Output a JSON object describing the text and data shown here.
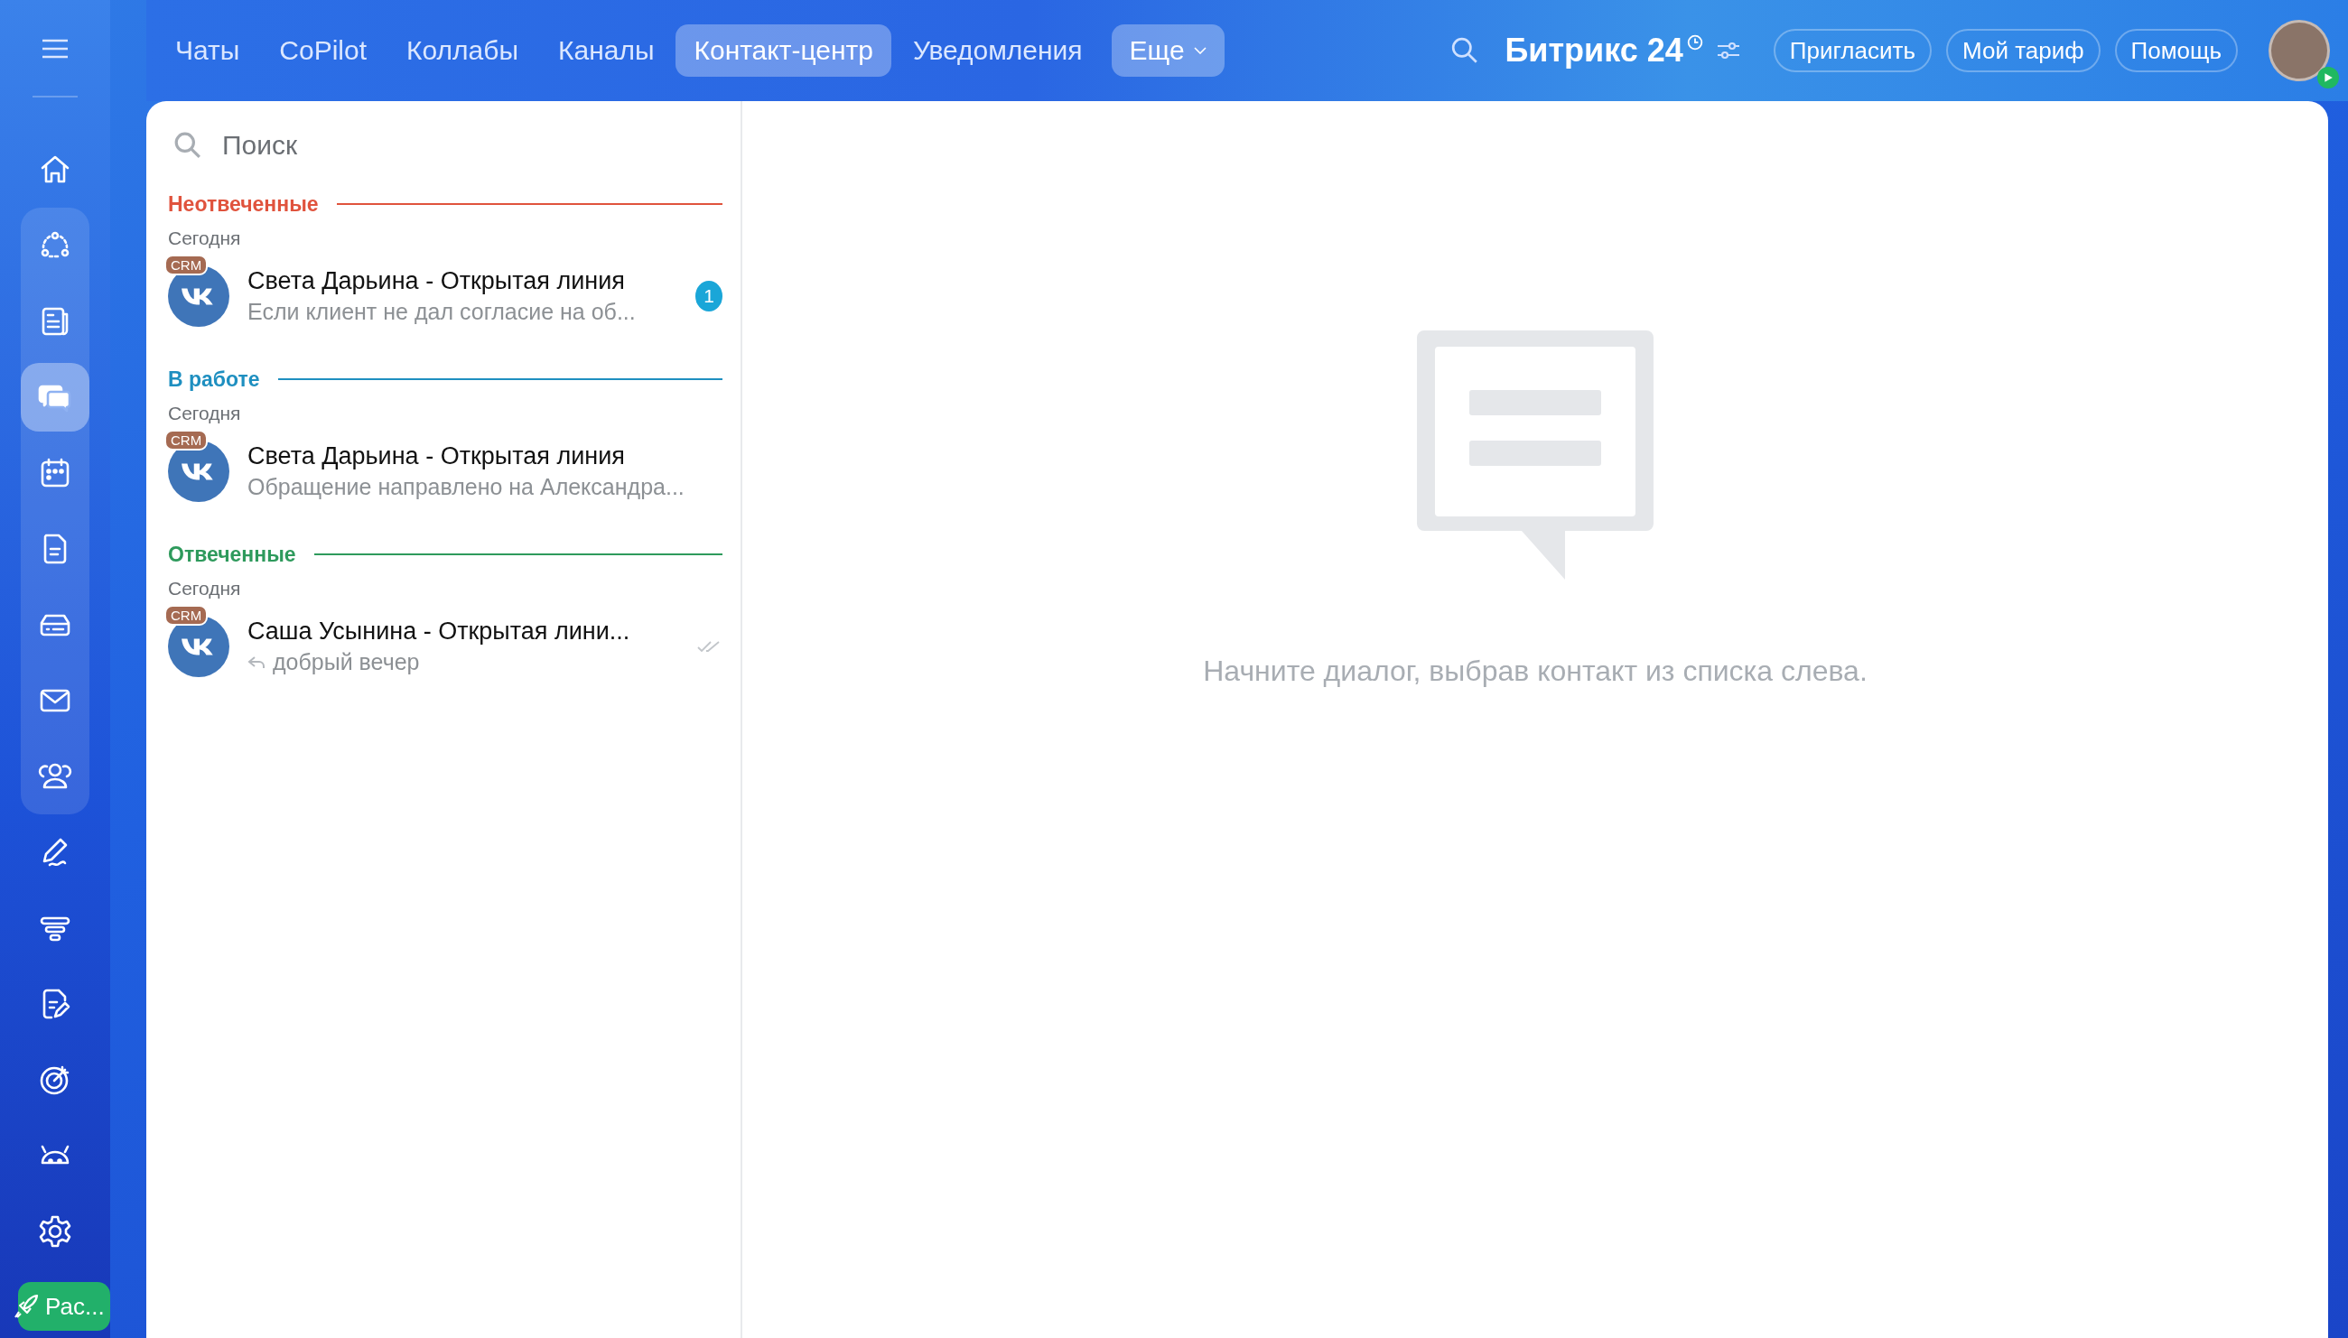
{
  "nav_tabs": [
    {
      "label": "Чаты",
      "selected": false,
      "kind": "plain"
    },
    {
      "label": "CoPilot",
      "selected": false,
      "kind": "plain"
    },
    {
      "label": "Коллабы",
      "selected": false,
      "kind": "plain"
    },
    {
      "label": "Каналы",
      "selected": false,
      "kind": "plain"
    },
    {
      "label": "Контакт-центр",
      "selected": true,
      "kind": "plain"
    },
    {
      "label": "Уведомления",
      "selected": false,
      "kind": "plain"
    },
    {
      "label": "Еще",
      "selected": false,
      "kind": "dropdown"
    }
  ],
  "brand": {
    "name": "Битрикс 24"
  },
  "header_buttons": [
    "Пригласить",
    "Мой тариф",
    "Помощь"
  ],
  "sidebar": {
    "items": [
      {
        "selected": false,
        "grouped": false
      },
      {
        "selected": false,
        "grouped": true
      },
      {
        "selected": false,
        "grouped": true
      },
      {
        "selected": true,
        "grouped": true
      },
      {
        "selected": false,
        "grouped": true
      },
      {
        "selected": false,
        "grouped": true
      },
      {
        "selected": false,
        "grouped": true
      },
      {
        "selected": false,
        "grouped": true
      },
      {
        "selected": false,
        "grouped": true
      },
      {
        "selected": false,
        "grouped": false
      },
      {
        "selected": false,
        "grouped": false
      },
      {
        "selected": false,
        "grouped": false
      },
      {
        "selected": false,
        "grouped": false
      },
      {
        "selected": false,
        "grouped": false
      },
      {
        "selected": false,
        "grouped": false
      }
    ],
    "launch_button": "Рас..."
  },
  "search": {
    "placeholder": "Поиск"
  },
  "groups": [
    {
      "title": "Неотвеченные",
      "color": "#e0533d",
      "date": "Сегодня",
      "chats": [
        {
          "badge": "CRM",
          "name": "Света Дарьина - Открытая линия",
          "preview": "Если клиент не дал согласие на об...",
          "counter": "1",
          "read": false,
          "replied": false
        }
      ]
    },
    {
      "title": "В работе",
      "color": "#1e8fc0",
      "date": "Сегодня",
      "chats": [
        {
          "badge": "CRM",
          "name": "Света Дарьина - Открытая линия",
          "preview": "Обращение направлено на Александра...",
          "read": false,
          "replied": false
        }
      ]
    },
    {
      "title": "Отвеченные",
      "color": "#2e9a5c",
      "date": "Сегодня",
      "chats": [
        {
          "badge": "CRM",
          "name": "Саша Усынина - Открытая лини...",
          "preview": "добрый вечер",
          "read": true,
          "replied": true
        }
      ]
    }
  ],
  "empty_state": {
    "message": "Начните диалог, выбрав контакт из списка слева."
  }
}
